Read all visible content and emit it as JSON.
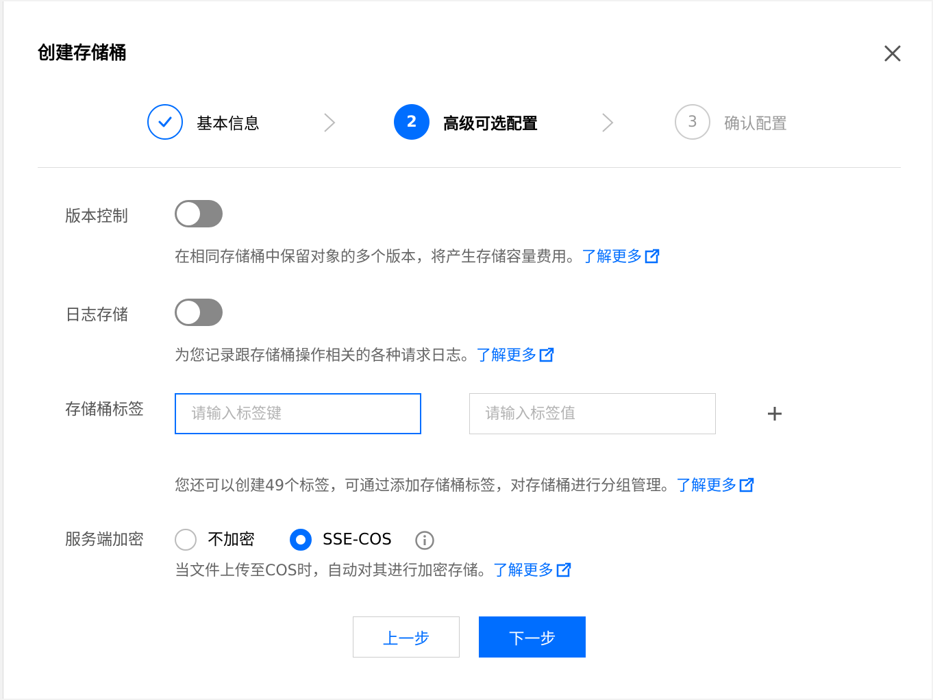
{
  "dialog": {
    "title": "创建存储桶"
  },
  "steps": [
    {
      "number": "✓",
      "label": "基本信息",
      "state": "done"
    },
    {
      "number": "2",
      "label": "高级可选配置",
      "state": "active"
    },
    {
      "number": "3",
      "label": "确认配置",
      "state": "pending"
    }
  ],
  "versioning": {
    "label": "版本控制",
    "enabled": false,
    "description": "在相同存储桶中保留对象的多个版本，将产生存储容量费用。",
    "link": "了解更多"
  },
  "logging": {
    "label": "日志存储",
    "enabled": false,
    "description": "为您记录跟存储桶操作相关的各种请求日志。",
    "link": "了解更多"
  },
  "tags": {
    "label": "存储桶标签",
    "key_value": "",
    "key_placeholder": "请输入标签键",
    "value_value": "",
    "value_placeholder": "请输入标签值",
    "add_symbol": "+",
    "description": "您还可以创建49个标签，可通过添加存储桶标签，对存储桶进行分组管理。",
    "link": "了解更多"
  },
  "encryption": {
    "label": "服务端加密",
    "options": [
      {
        "label": "不加密",
        "selected": false
      },
      {
        "label": "SSE-COS",
        "selected": true
      }
    ],
    "description": "当文件上传至COS时，自动对其进行加密存储。",
    "link": "了解更多"
  },
  "footer": {
    "prev_label": "上一步",
    "next_label": "下一步"
  },
  "colors": {
    "primary": "#006eff",
    "toggle_off": "#888888",
    "muted_text": "#666666"
  },
  "icons": {
    "close": "close-icon",
    "check": "check-icon",
    "chevron": "chevron-right-icon",
    "external": "external-link-icon",
    "info": "info-icon",
    "plus": "plus-icon"
  }
}
